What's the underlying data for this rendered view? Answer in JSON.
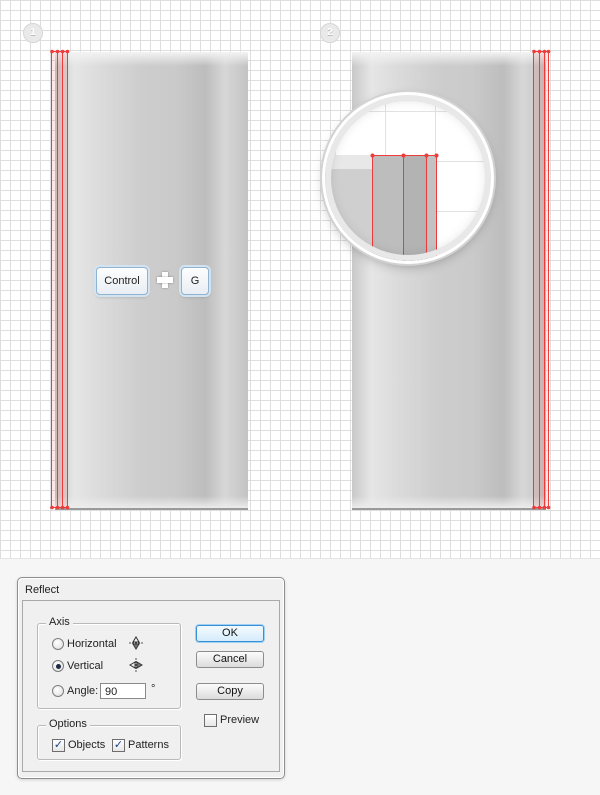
{
  "steps": {
    "one": "1",
    "two": "2"
  },
  "shortcut": {
    "key1": "Control",
    "key2": "G"
  },
  "colors": {
    "guide": "#ee3b3b",
    "grid": "#dedede",
    "button_default": "#3a8fd2"
  },
  "dialog": {
    "title": "Reflect",
    "axis": {
      "legend": "Axis",
      "horizontal_label": "Horizontal",
      "vertical_label": "Vertical",
      "angle_label": "Angle:",
      "angle_value": "90",
      "degree_symbol": "°",
      "selected": "vertical",
      "horizontal_icon": "reflect-horizontal-icon",
      "vertical_icon": "reflect-vertical-icon"
    },
    "options": {
      "legend": "Options",
      "objects_label": "Objects",
      "objects_checked": true,
      "patterns_label": "Patterns",
      "patterns_checked": true
    },
    "buttons": {
      "ok": "OK",
      "cancel": "Cancel",
      "copy": "Copy"
    },
    "preview_label": "Preview",
    "preview_checked": false
  }
}
